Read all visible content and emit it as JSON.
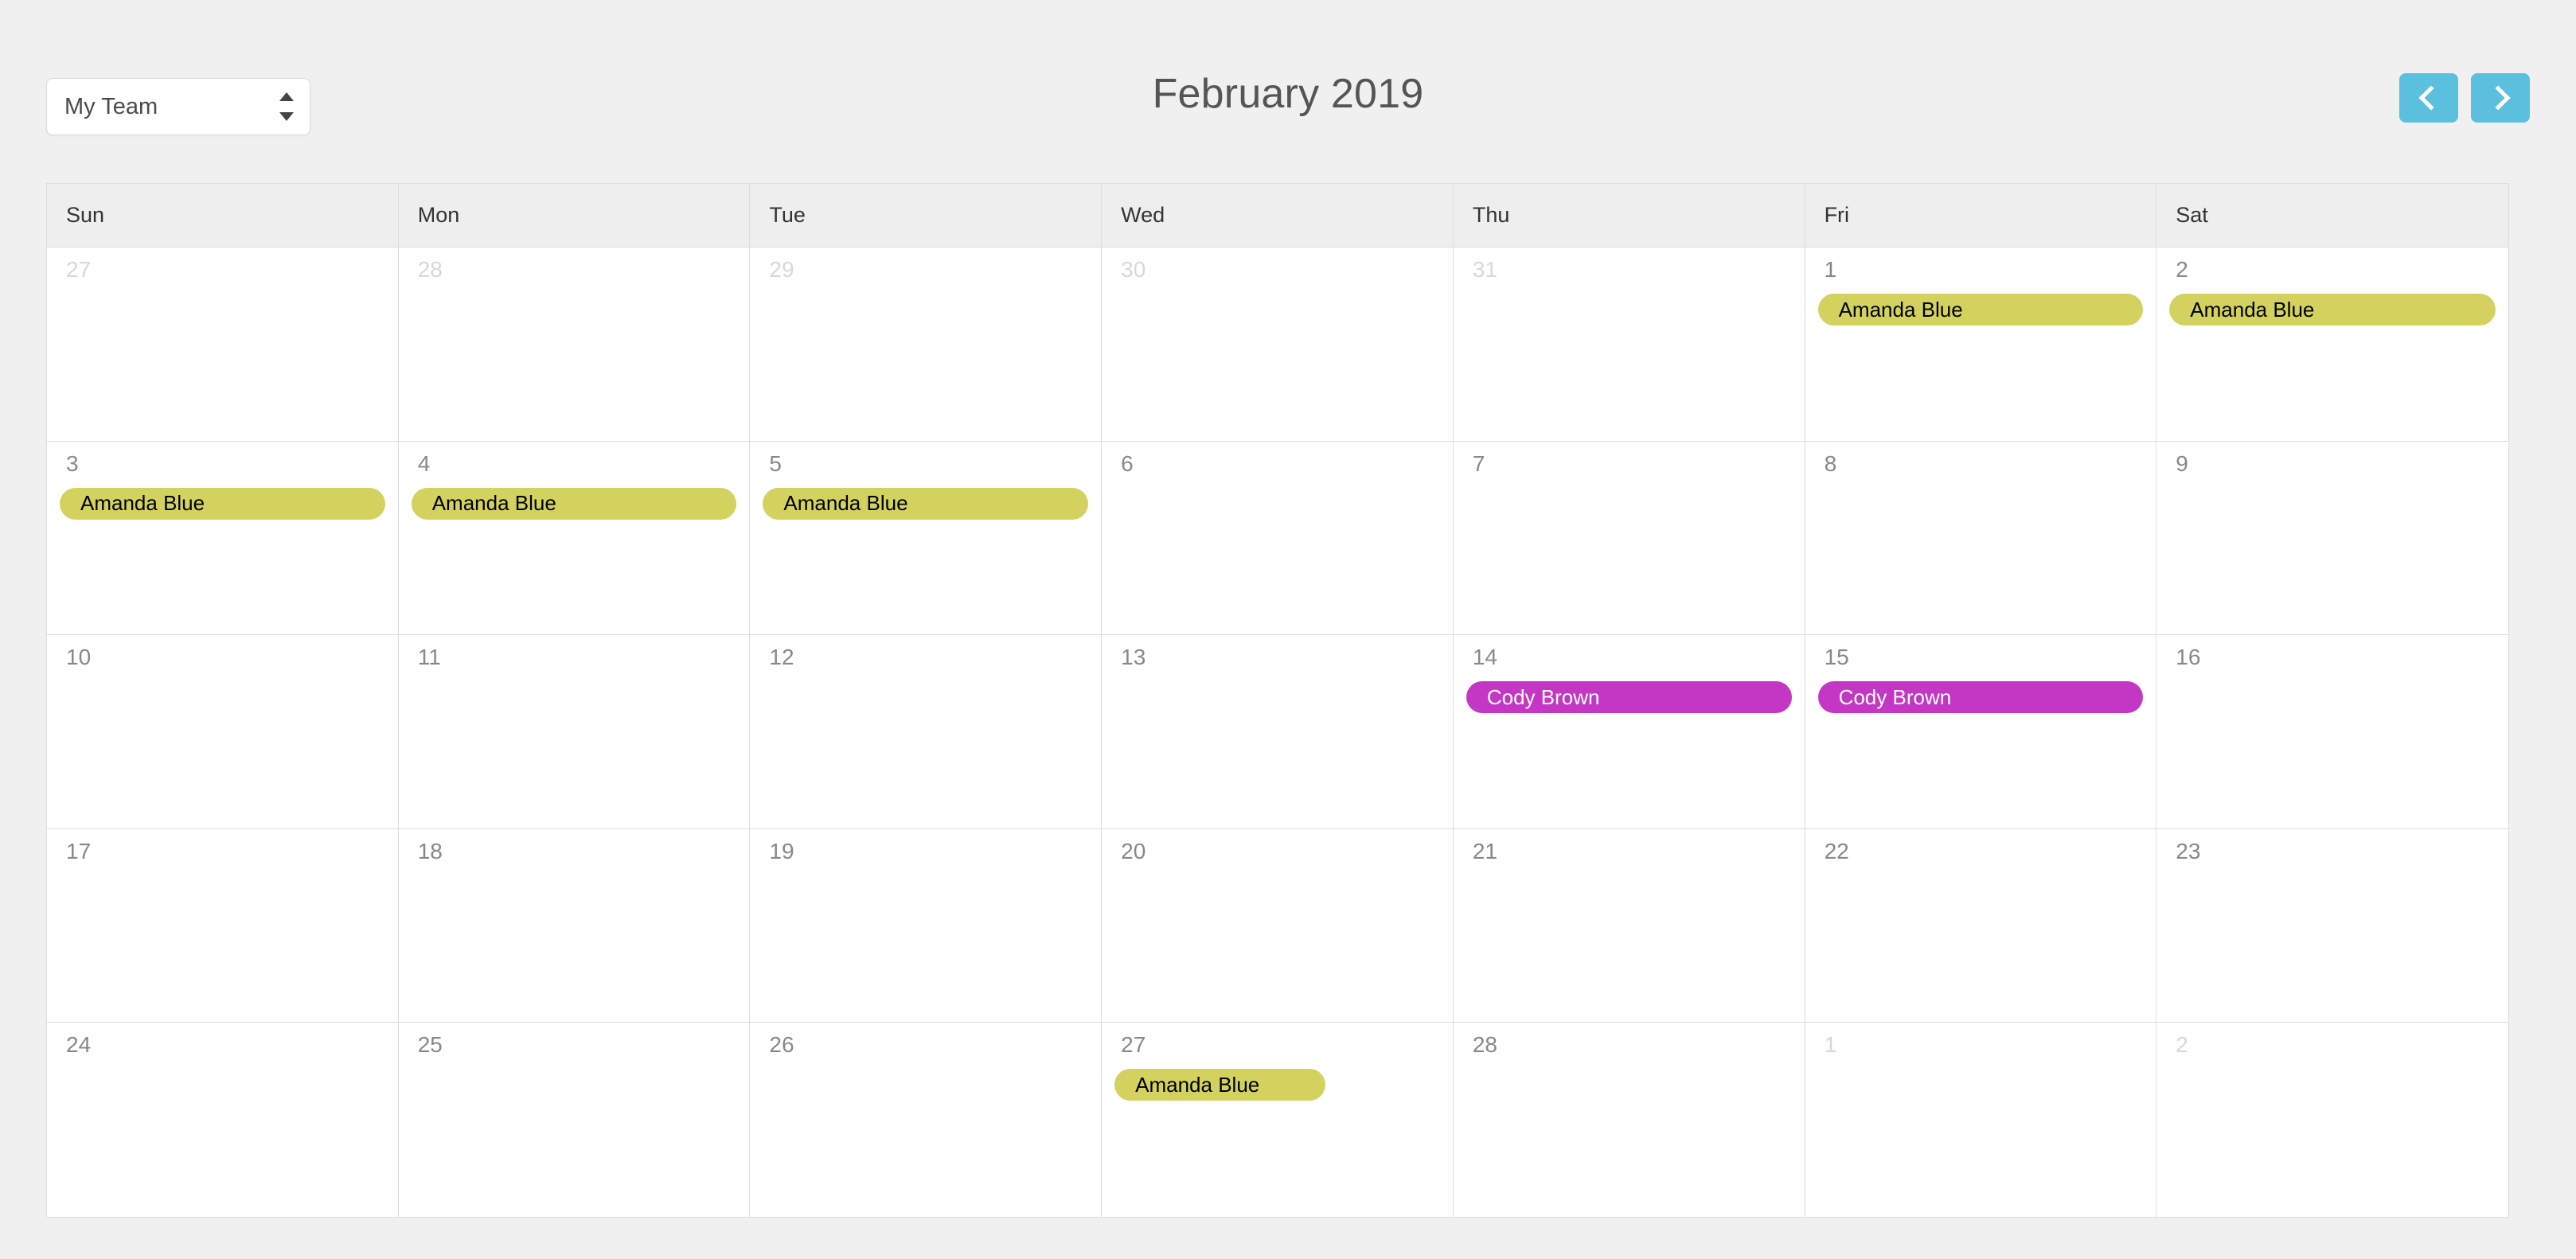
{
  "toolbar": {
    "team_select": {
      "value": "My Team",
      "icon": "spinner-arrows-icon"
    },
    "title": "February 2019",
    "prev_label": "‹",
    "next_label": "›",
    "prev_icon": "chevron-left-icon",
    "next_icon": "chevron-right-icon"
  },
  "colors": {
    "page_background": "#f0f0f0",
    "nav_button": "#5bc0de",
    "grid_border": "#dddddd",
    "header_background": "#eeeeee",
    "event_amanda": "#d3d25e",
    "event_cody": "#c437c4"
  },
  "calendar": {
    "day_names": [
      "Sun",
      "Mon",
      "Tue",
      "Wed",
      "Thu",
      "Fri",
      "Sat"
    ],
    "weeks": [
      [
        {
          "day": "27",
          "other_month": true,
          "events": []
        },
        {
          "day": "28",
          "other_month": true,
          "events": []
        },
        {
          "day": "29",
          "other_month": true,
          "events": []
        },
        {
          "day": "30",
          "other_month": true,
          "events": []
        },
        {
          "day": "31",
          "other_month": true,
          "events": []
        },
        {
          "day": "1",
          "other_month": false,
          "events": [
            {
              "label": "Amanda Blue",
              "color": "#d3d25e",
              "text_color": "#000000",
              "width": "full"
            }
          ]
        },
        {
          "day": "2",
          "other_month": false,
          "events": [
            {
              "label": "Amanda Blue",
              "color": "#d3d25e",
              "text_color": "#000000",
              "width": "full"
            }
          ]
        }
      ],
      [
        {
          "day": "3",
          "other_month": false,
          "events": [
            {
              "label": "Amanda Blue",
              "color": "#d3d25e",
              "text_color": "#000000",
              "width": "full"
            }
          ]
        },
        {
          "day": "4",
          "other_month": false,
          "events": [
            {
              "label": "Amanda Blue",
              "color": "#d3d25e",
              "text_color": "#000000",
              "width": "full"
            }
          ]
        },
        {
          "day": "5",
          "other_month": false,
          "events": [
            {
              "label": "Amanda Blue",
              "color": "#d3d25e",
              "text_color": "#000000",
              "width": "full"
            }
          ]
        },
        {
          "day": "6",
          "other_month": false,
          "events": []
        },
        {
          "day": "7",
          "other_month": false,
          "events": []
        },
        {
          "day": "8",
          "other_month": false,
          "events": []
        },
        {
          "day": "9",
          "other_month": false,
          "events": []
        }
      ],
      [
        {
          "day": "10",
          "other_month": false,
          "events": []
        },
        {
          "day": "11",
          "other_month": false,
          "events": []
        },
        {
          "day": "12",
          "other_month": false,
          "events": []
        },
        {
          "day": "13",
          "other_month": false,
          "events": []
        },
        {
          "day": "14",
          "other_month": false,
          "events": [
            {
              "label": "Cody Brown",
              "color": "#c437c4",
              "text_color": "#ffffff",
              "width": "full"
            }
          ]
        },
        {
          "day": "15",
          "other_month": false,
          "events": [
            {
              "label": "Cody Brown",
              "color": "#c437c4",
              "text_color": "#ffffff",
              "width": "full"
            }
          ]
        },
        {
          "day": "16",
          "other_month": false,
          "events": []
        }
      ],
      [
        {
          "day": "17",
          "other_month": false,
          "events": []
        },
        {
          "day": "18",
          "other_month": false,
          "events": []
        },
        {
          "day": "19",
          "other_month": false,
          "events": []
        },
        {
          "day": "20",
          "other_month": false,
          "events": []
        },
        {
          "day": "21",
          "other_month": false,
          "events": []
        },
        {
          "day": "22",
          "other_month": false,
          "events": []
        },
        {
          "day": "23",
          "other_month": false,
          "events": []
        }
      ],
      [
        {
          "day": "24",
          "other_month": false,
          "events": []
        },
        {
          "day": "25",
          "other_month": false,
          "events": []
        },
        {
          "day": "26",
          "other_month": false,
          "events": []
        },
        {
          "day": "27",
          "other_month": false,
          "events": [
            {
              "label": "Amanda Blue",
              "color": "#d3d25e",
              "text_color": "#000000",
              "width": "short"
            }
          ]
        },
        {
          "day": "28",
          "other_month": false,
          "events": []
        },
        {
          "day": "1",
          "other_month": true,
          "events": []
        },
        {
          "day": "2",
          "other_month": true,
          "events": []
        }
      ]
    ]
  }
}
